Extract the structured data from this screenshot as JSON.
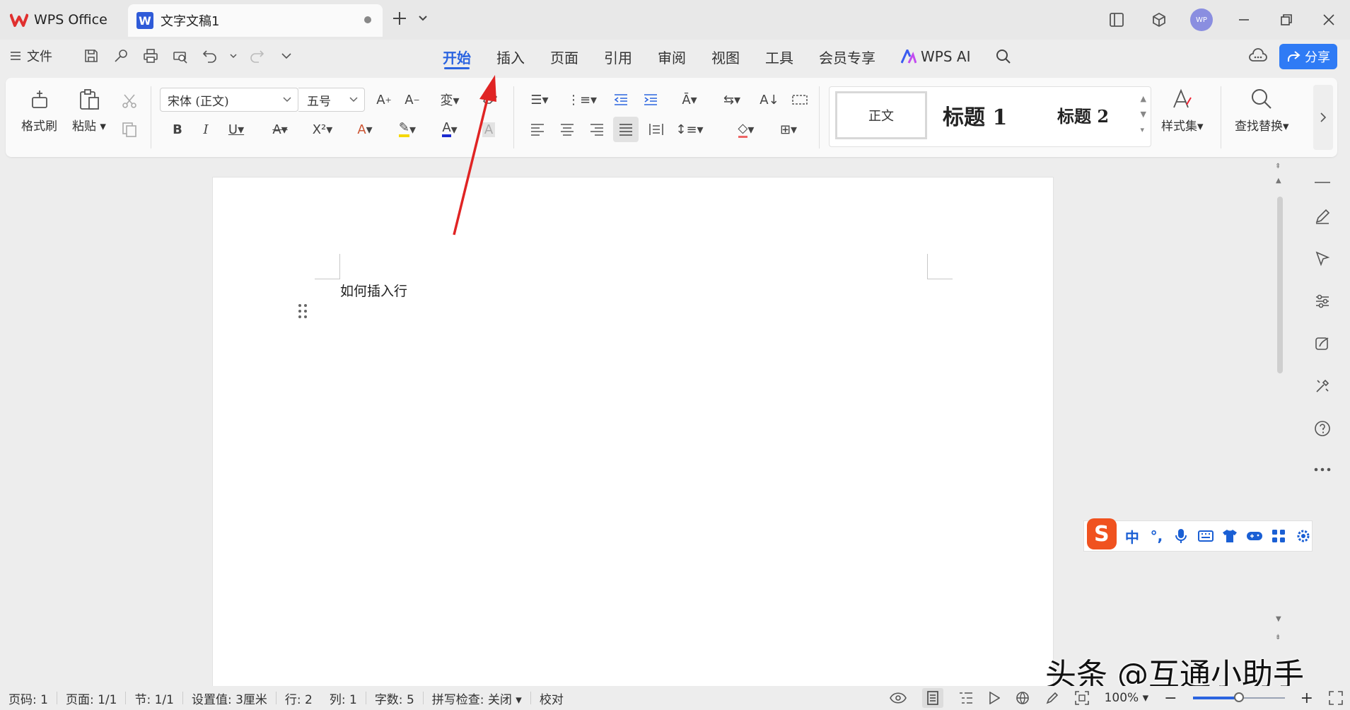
{
  "titlebar": {
    "app_tab_label": "WPS Office",
    "doc_tab_label": "文字文稿1",
    "doc_badge": "W",
    "avatar_text": "WP"
  },
  "menubar": {
    "file_label": "文件",
    "tabs": [
      "开始",
      "插入",
      "页面",
      "引用",
      "审阅",
      "视图",
      "工具",
      "会员专享"
    ],
    "active_tab": "开始",
    "ai_label": "WPS AI",
    "share_label": "分享"
  },
  "ribbon": {
    "format_painter_label": "格式刷",
    "paste_label": "粘贴",
    "font_name": "宋体 (正文)",
    "font_size": "五号",
    "style_normal": "正文",
    "style_h1": "标题 1",
    "style_h2": "标题 2",
    "style_set_label": "样式集",
    "find_replace_label": "查找替换"
  },
  "document": {
    "text": "如何插入行"
  },
  "ime": {
    "logo": "S",
    "mode": "中",
    "punct": "°,"
  },
  "watermark": "头条 @互通小助手",
  "status": {
    "page_no": "页码: 1",
    "pages": "页面: 1/1",
    "section": "节: 1/1",
    "setting": "设置值: 3厘米",
    "row": "行: 2",
    "col": "列: 1",
    "words": "字数: 5",
    "spell": "拼写检查: 关闭",
    "proof": "校对",
    "zoom": "100%",
    "zoom_fraction": 0.5
  },
  "colors": {
    "accent": "#2b64e0",
    "share_bg": "#2f7bf5",
    "arrow": "#e02424"
  }
}
